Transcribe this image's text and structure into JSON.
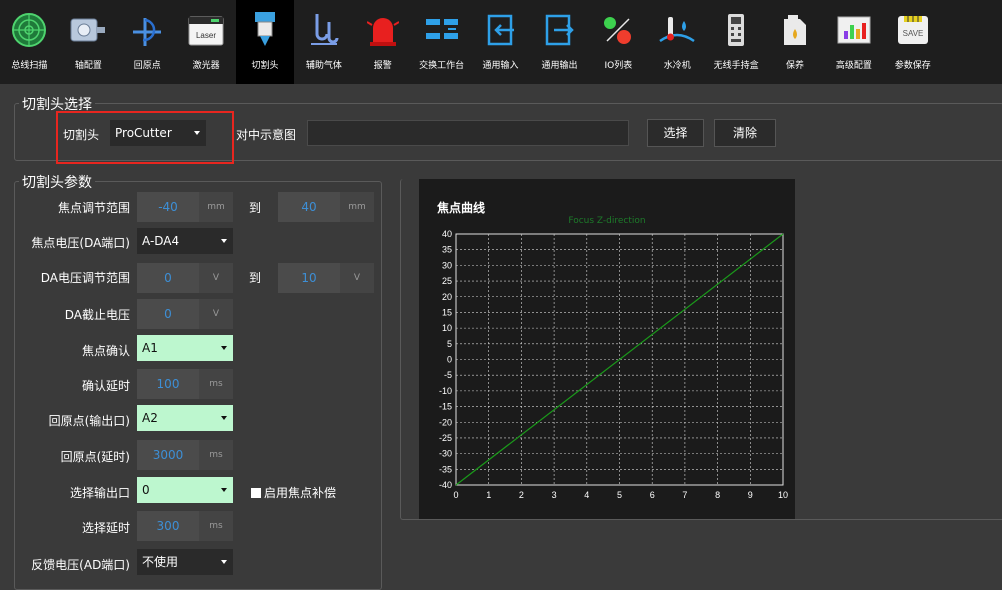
{
  "toolbar": {
    "items": [
      {
        "label": "总线扫描",
        "icon": "radar-icon"
      },
      {
        "label": "轴配置",
        "icon": "motor-icon"
      },
      {
        "label": "回原点",
        "icon": "home-return-icon"
      },
      {
        "label": "激光器",
        "icon": "laser-icon",
        "icon_text": "Laser"
      },
      {
        "label": "切割头",
        "icon": "cutting-head-icon",
        "active": true
      },
      {
        "label": "辅助气体",
        "icon": "gas-icon"
      },
      {
        "label": "报警",
        "icon": "alarm-icon"
      },
      {
        "label": "交换工作台",
        "icon": "exchange-table-icon"
      },
      {
        "label": "通用输入",
        "icon": "input-icon"
      },
      {
        "label": "通用输出",
        "icon": "output-icon"
      },
      {
        "label": "IO列表",
        "icon": "io-list-icon"
      },
      {
        "label": "水冷机",
        "icon": "water-chiller-icon"
      },
      {
        "label": "无线手持盒",
        "icon": "wireless-remote-icon"
      },
      {
        "label": "保养",
        "icon": "maintenance-icon"
      },
      {
        "label": "高级配置",
        "icon": "advanced-config-icon"
      },
      {
        "label": "参数保存",
        "icon": "save-icon",
        "icon_text": "SAVE"
      }
    ]
  },
  "head_select": {
    "group_title": "切割头选择",
    "head_label": "切割头",
    "head_value": "ProCutter",
    "diagram_label": "对中示意图",
    "diagram_path": "",
    "select_button": "选择",
    "clear_button": "清除"
  },
  "params": {
    "group_title": "切割头参数",
    "focus_range_label": "焦点调节范围",
    "focus_min": "-40",
    "focus_max": "40",
    "unit_mm": "mm",
    "to_label": "到",
    "focus_voltage_label": "焦点电压(DA端口)",
    "focus_voltage_value": "A-DA4",
    "da_range_label": "DA电压调节范围",
    "da_min": "0",
    "da_max": "10",
    "unit_v": "V",
    "da_cutoff_label": "DA截止电压",
    "da_cutoff": "0",
    "focus_confirm_label": "焦点确认",
    "focus_confirm_value": "A1",
    "confirm_delay_label": "确认延时",
    "confirm_delay": "100",
    "unit_ms": "ms",
    "home_output_label": "回原点(输出口)",
    "home_output_value": "A2",
    "home_delay_label": "回原点(延时)",
    "home_delay": "3000",
    "select_output_label": "选择输出口",
    "select_output_value": "0",
    "enable_comp_label": "启用焦点补偿",
    "enable_comp_checked": false,
    "select_delay_label": "选择延时",
    "select_delay": "300",
    "feedback_label": "反馈电压(AD端口)",
    "feedback_value": "不使用"
  },
  "chart_title": "焦点曲线",
  "chart_data": {
    "type": "line",
    "title": "Focus Z-direction",
    "x": [
      0,
      10
    ],
    "series": [
      {
        "values": [
          -40,
          40
        ],
        "color": "#1a9a1a"
      }
    ],
    "xlim": [
      0,
      10
    ],
    "ylim": [
      -40,
      40
    ],
    "xticks": [
      0,
      1,
      2,
      3,
      4,
      5,
      6,
      7,
      8,
      9,
      10
    ],
    "yticks": [
      40,
      35,
      30,
      25,
      20,
      15,
      10,
      5,
      0,
      -5,
      -10,
      -15,
      -20,
      -25,
      -30,
      -35,
      -40
    ],
    "grid": true
  }
}
